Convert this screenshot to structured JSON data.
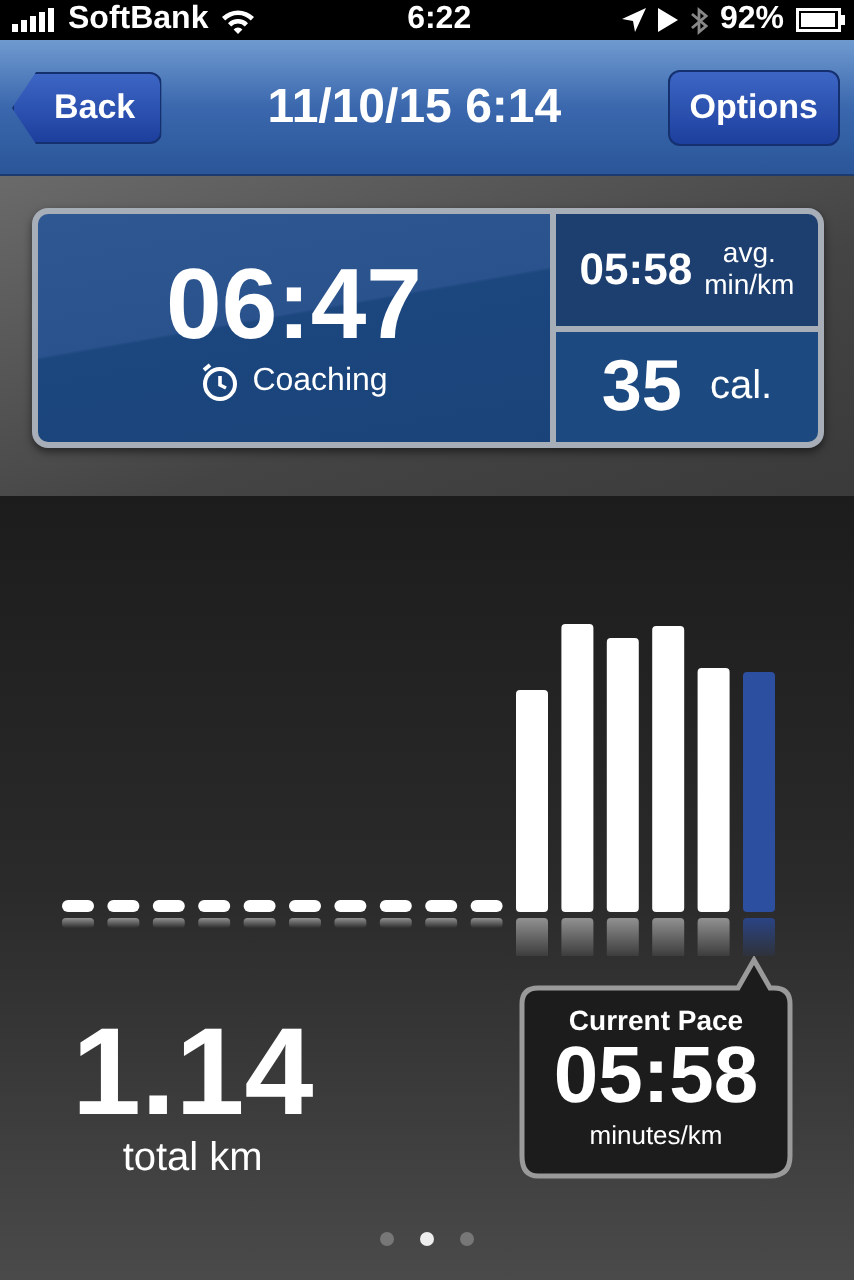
{
  "status_bar": {
    "carrier": "SoftBank",
    "time": "6:22",
    "battery": "92%"
  },
  "nav": {
    "back": "Back",
    "title": "11/10/15 6:14",
    "options": "Options"
  },
  "summary": {
    "duration": "06:47",
    "mode": "Coaching",
    "avg_pace": "05:58",
    "avg_unit_1": "avg.",
    "avg_unit_2": "min/km",
    "calories": "35",
    "calories_unit": "cal."
  },
  "distance": {
    "value": "1.14",
    "unit": "total km"
  },
  "current_pace": {
    "title": "Current Pace",
    "value": "05:58",
    "unit": "minutes/km"
  },
  "pages": [
    {
      "selected": false
    },
    {
      "selected": true
    },
    {
      "selected": false
    }
  ]
}
